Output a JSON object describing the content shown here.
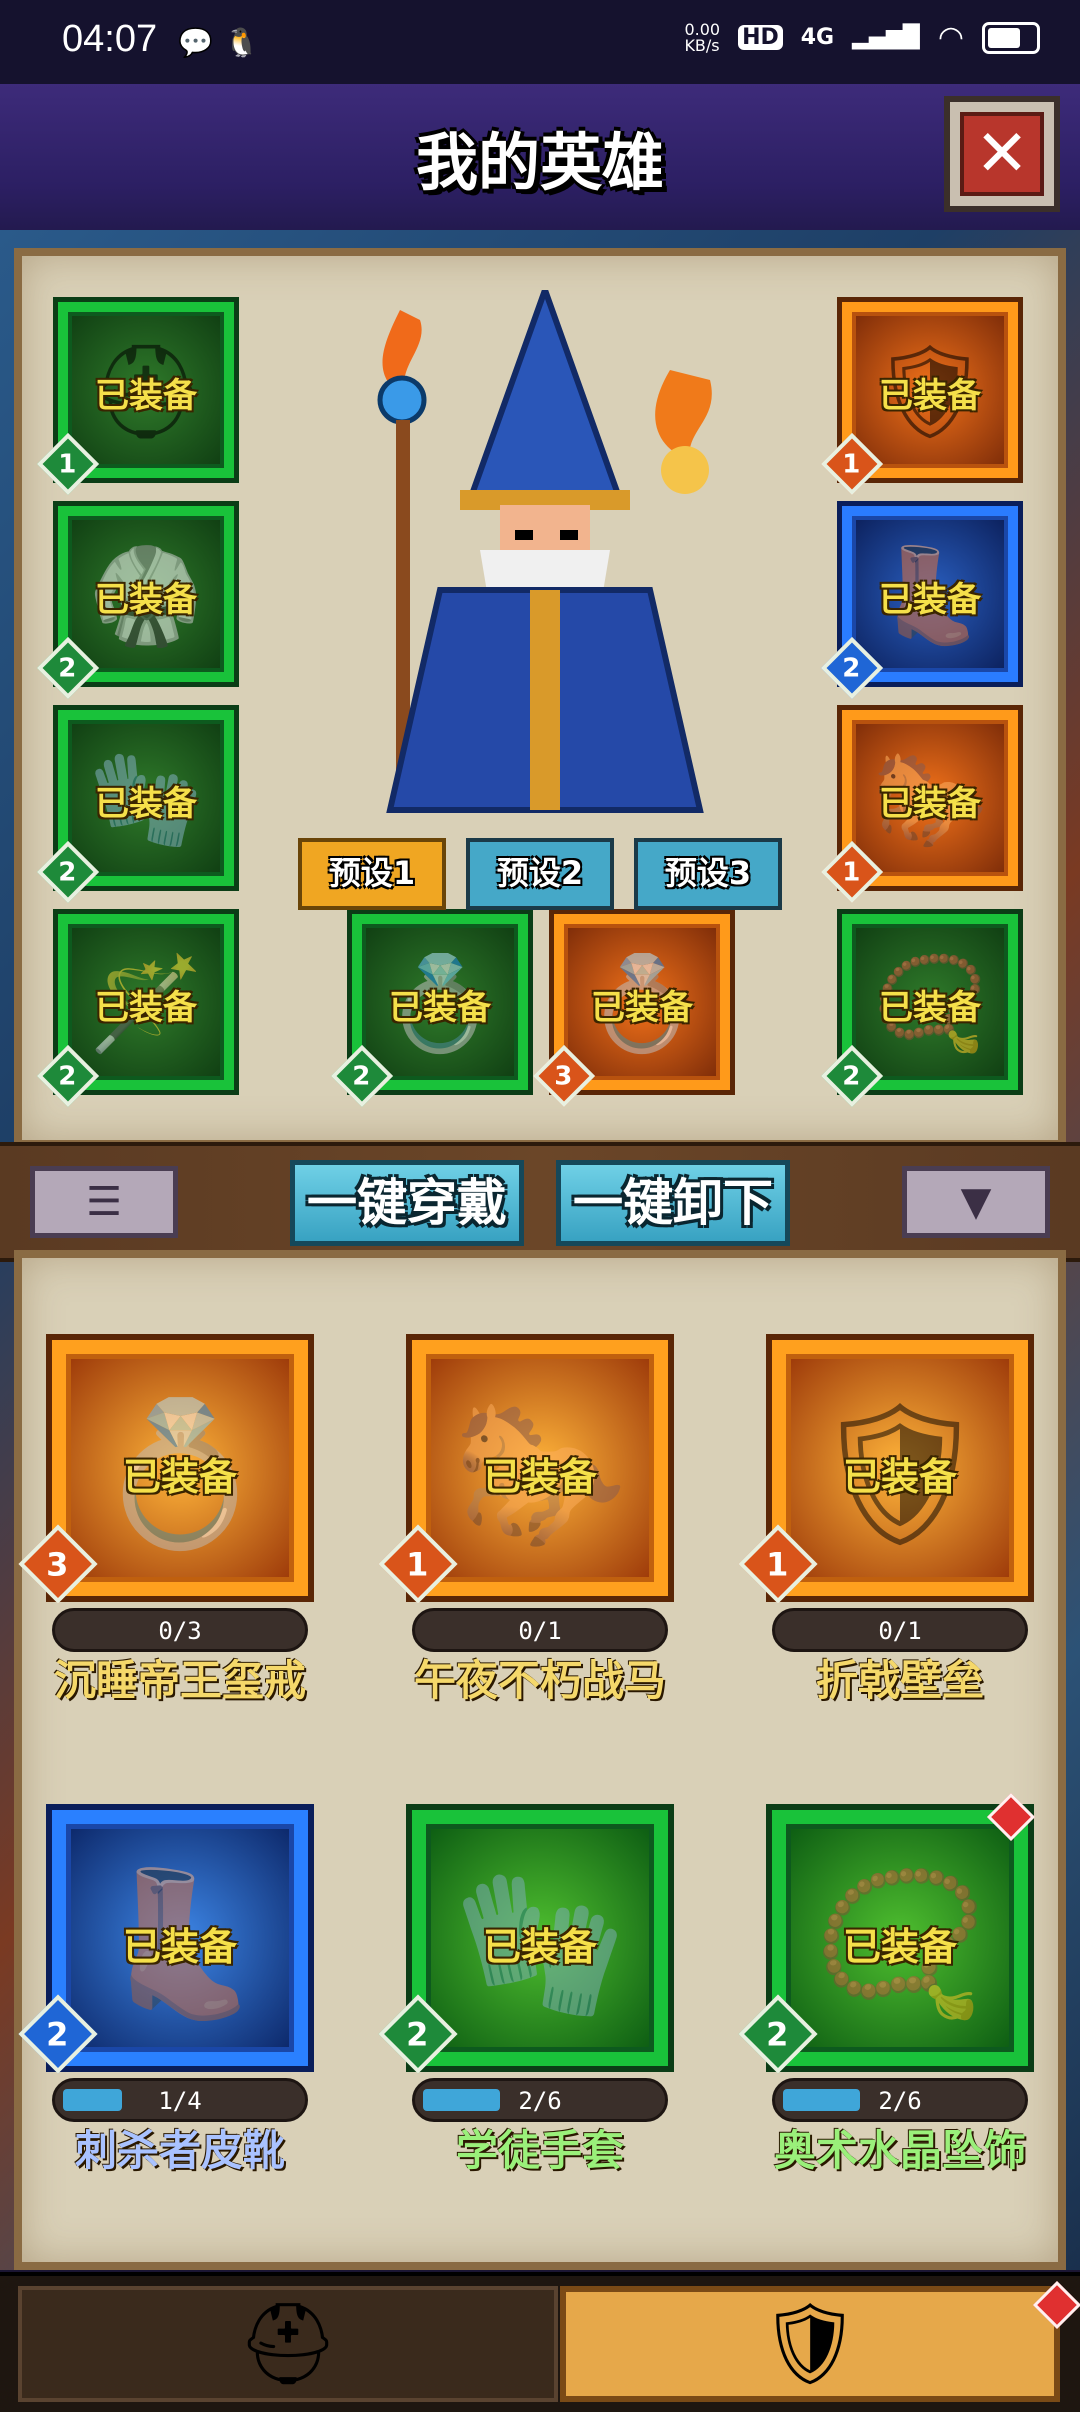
{
  "status_bar": {
    "time": "04:07",
    "net_speed": "0.00\nKB/s",
    "hd": "HD",
    "signal": "4G"
  },
  "header": {
    "title": "我的英雄",
    "close_icon": "close-icon"
  },
  "equipped_label": "已装备",
  "slots": [
    {
      "id": "slot-helmet",
      "tier": "1",
      "color": "green",
      "icon": "hood-icon"
    },
    {
      "id": "slot-armor",
      "tier": "2",
      "color": "green",
      "icon": "robe-icon"
    },
    {
      "id": "slot-gloves",
      "tier": "2",
      "color": "green",
      "icon": "glove-icon"
    },
    {
      "id": "slot-staff",
      "tier": "2",
      "color": "green",
      "icon": "staff-icon"
    },
    {
      "id": "slot-ring1",
      "tier": "2",
      "color": "green",
      "icon": "ring-icon"
    },
    {
      "id": "slot-ring2",
      "tier": "3",
      "color": "orange",
      "icon": "ring-icon"
    },
    {
      "id": "slot-shield",
      "tier": "1",
      "color": "orange",
      "icon": "shield-icon"
    },
    {
      "id": "slot-boots",
      "tier": "2",
      "color": "blue",
      "icon": "boots-icon"
    },
    {
      "id": "slot-mount",
      "tier": "1",
      "color": "orange",
      "icon": "horse-icon"
    },
    {
      "id": "slot-amulet",
      "tier": "2",
      "color": "green",
      "icon": "amulet-icon"
    }
  ],
  "presets": [
    "预设1",
    "预设2",
    "预设3"
  ],
  "actions": {
    "equip_all": "一键穿戴",
    "unequip_all": "一键卸下"
  },
  "inventory": [
    {
      "name": "沉睡帝王玺戒",
      "tier": "3",
      "color": "orange",
      "progress": "0/3",
      "fill": 0,
      "name_color": "gold",
      "icon": "ring-icon"
    },
    {
      "name": "午夜不朽战马",
      "tier": "1",
      "color": "orange",
      "progress": "0/1",
      "fill": 0,
      "name_color": "gold",
      "icon": "horse-icon"
    },
    {
      "name": "折戟壁垒",
      "tier": "1",
      "color": "orange",
      "progress": "0/1",
      "fill": 0,
      "name_color": "gold",
      "icon": "shield-icon"
    },
    {
      "name": "刺杀者皮靴",
      "tier": "2",
      "color": "blue",
      "progress": "1/4",
      "fill": 0.25,
      "name_color": "blue",
      "icon": "boots-icon"
    },
    {
      "name": "学徒手套",
      "tier": "2",
      "color": "green",
      "progress": "2/6",
      "fill": 0.33,
      "name_color": "green",
      "icon": "glove-icon"
    },
    {
      "name": "奥术水晶坠饰",
      "tier": "2",
      "color": "green",
      "progress": "2/6",
      "fill": 0.33,
      "name_color": "green",
      "icon": "amulet-icon"
    }
  ],
  "bottom_nav": [
    {
      "id": "tab-heroes",
      "icon": "helmet-icon"
    },
    {
      "id": "tab-equipment",
      "icon": "armor-icon"
    }
  ]
}
